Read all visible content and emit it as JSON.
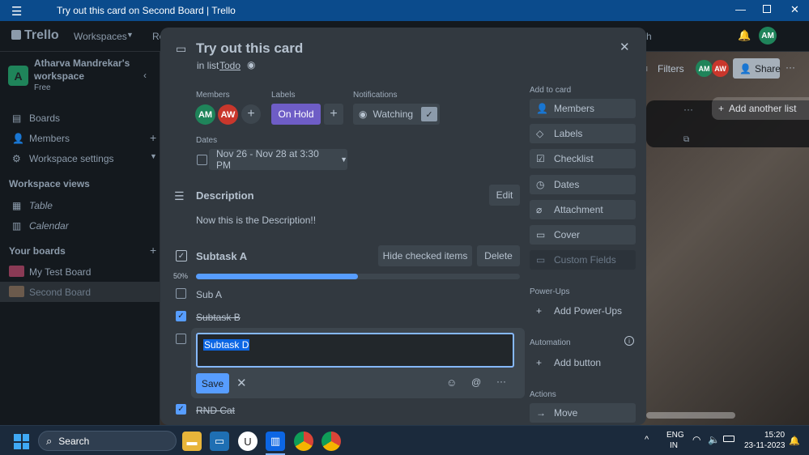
{
  "window": {
    "title": "Try out this card on Second Board | Trello"
  },
  "appbar": {
    "logo": "Trello",
    "workspaces": "Workspaces",
    "recent_partial": "Re",
    "search_partial": "h",
    "user_initials": "AM"
  },
  "sidebar": {
    "workspace_initial": "A",
    "workspace_name_1": "Atharva Mandrekar's",
    "workspace_name_2": "workspace",
    "plan": "Free",
    "items": [
      "Boards",
      "Members",
      "Workspace settings"
    ],
    "views_header": "Workspace views",
    "views": [
      "Table",
      "Calendar"
    ],
    "boards_header": "Your boards",
    "boards": [
      "My Test Board",
      "Second Board"
    ]
  },
  "board": {
    "filters": "Filters",
    "share": "Share",
    "add_list": "Add another list",
    "members": [
      "AM",
      "AW"
    ]
  },
  "card": {
    "title": "Try out this card",
    "in_list_prefix": "in list",
    "list_name": "Todo",
    "members_label": "Members",
    "members": [
      "AM",
      "AW"
    ],
    "labels_label": "Labels",
    "label": "On Hold",
    "notifications_label": "Notifications",
    "watching": "Watching",
    "dates_label": "Dates",
    "dates_value": "Nov 26 - Nov 28 at 3:30 PM",
    "description_label": "Description",
    "edit": "Edit",
    "description": "Now this is the Description!!",
    "checklist_title": "Subtask A",
    "hide_checked": "Hide checked items",
    "delete": "Delete",
    "progress": "50%",
    "items": [
      {
        "text": "Sub A",
        "checked": false
      },
      {
        "text": "Subtask B",
        "checked": true
      },
      {
        "text": "Subtask D",
        "checked": false
      },
      {
        "text": "RND Cat",
        "checked": true
      }
    ],
    "editor_value": "Subtask D",
    "save": "Save"
  },
  "sidepanel": {
    "add_to_card": "Add to card",
    "buttons": [
      "Members",
      "Labels",
      "Checklist",
      "Dates",
      "Attachment",
      "Cover",
      "Custom Fields"
    ],
    "powerups_header": "Power-Ups",
    "add_powerups": "Add Power-Ups",
    "automation_header": "Automation",
    "add_button": "Add button",
    "actions_header": "Actions",
    "move": "Move"
  },
  "taskbar": {
    "search": "Search",
    "lang1": "ENG",
    "lang2": "IN",
    "time": "15:20",
    "date": "23-11-2023"
  }
}
